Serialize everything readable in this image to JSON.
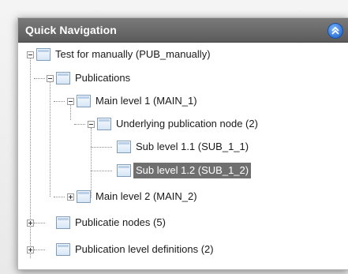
{
  "panel": {
    "title": "Quick Navigation"
  },
  "tree": {
    "nodes": [
      {
        "label": "Test for manually (PUB_manually)",
        "expanded": true
      },
      {
        "label": "Publications",
        "expanded": true
      },
      {
        "label": "Main level 1 (MAIN_1)",
        "expanded": true
      },
      {
        "label": "Underlying publication node (2)",
        "expanded": true
      },
      {
        "label": "Sub level 1.1 (SUB_1_1)"
      },
      {
        "label": "Sub level 1.2 (SUB_1_2)",
        "selected": true
      },
      {
        "label": "Main level 2 (MAIN_2)",
        "expanded": false
      },
      {
        "label": "Publicatie nodes (5)",
        "expanded": false
      },
      {
        "label": "Publication level definitions (2)",
        "expanded": false
      }
    ]
  },
  "colors": {
    "header_bg": "#666666",
    "selection_bg": "#6f6f6f",
    "collapse_button": "#2f74d6"
  }
}
